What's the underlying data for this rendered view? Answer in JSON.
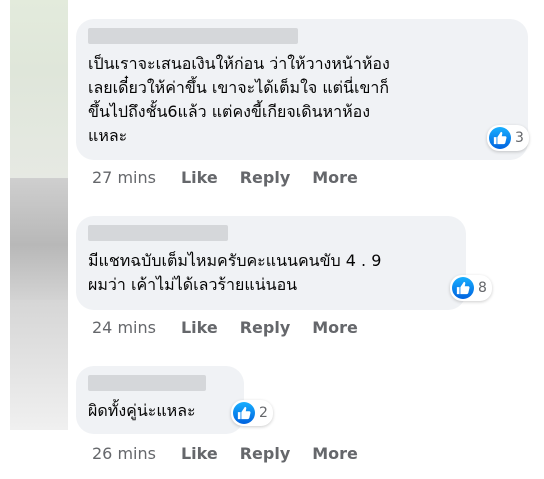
{
  "colors": {
    "bubble": "#f0f2f5",
    "text": "#050505",
    "meta": "#65676b",
    "like_gradient_top": "#18afff",
    "like_gradient_bottom": "#0062df"
  },
  "comments": [
    {
      "text": "เป็นเราจะเสนอเงินให้ก่อน ว่าให้วางหน้าห้อง\nเลยเดี๋ยวให้ค่าขึ้น เขาจะได้เต็มใจ แต่นี่เขาก็\nขึ้นไปถึงชั้น6แล้ว แต่คงขี้เกียจเดินหาห้อง\nแหละ",
      "reaction_icon": "like-icon",
      "reaction_count": "3",
      "time": "27 mins",
      "like_label": "Like",
      "reply_label": "Reply",
      "more_label": "More"
    },
    {
      "text": "มีแชทฉบับเต็มไหมครับคะแนนคนขับ 4 . 9\nผมว่า เค้าไม่ได้เลวร้ายแน่นอน",
      "reaction_icon": "like-icon",
      "reaction_count": "8",
      "time": "24 mins",
      "like_label": "Like",
      "reply_label": "Reply",
      "more_label": "More"
    },
    {
      "text": "ผิดทั้งคู่น่ะแหละ",
      "reaction_icon": "like-icon",
      "reaction_count": "2",
      "time": "26 mins",
      "like_label": "Like",
      "reply_label": "Reply",
      "more_label": "More"
    }
  ]
}
